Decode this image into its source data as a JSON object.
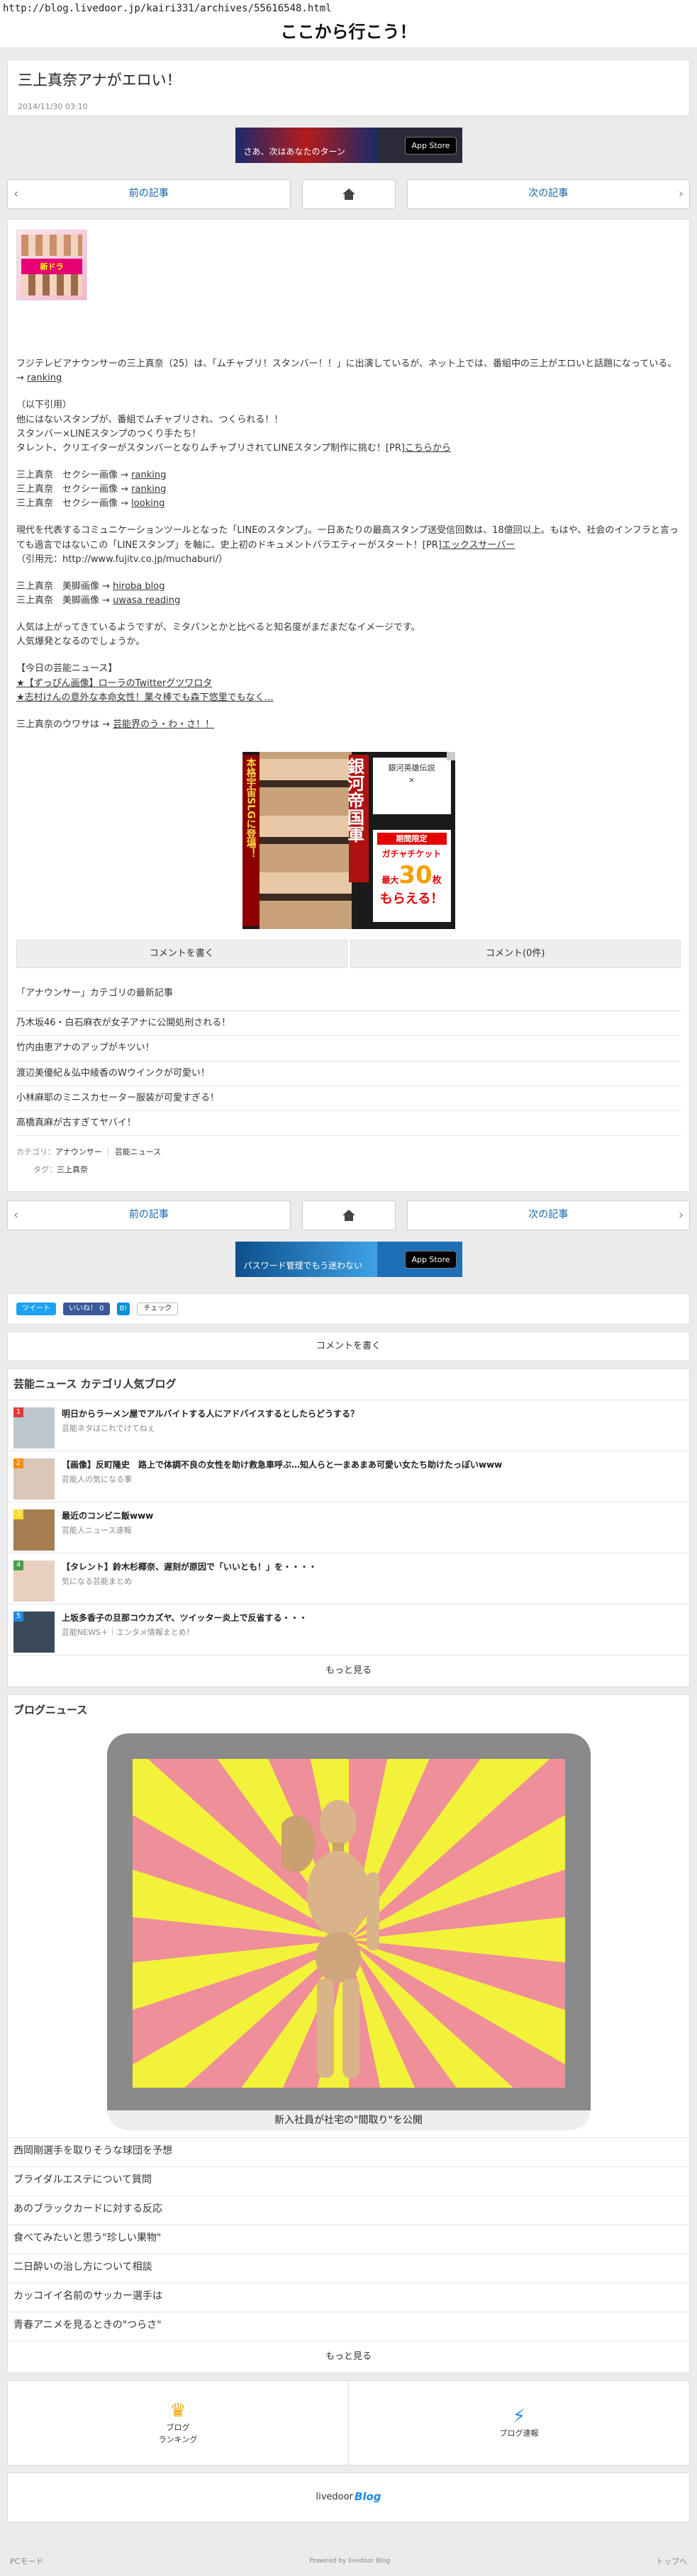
{
  "url": "http://blog.livedoor.jp/kairi331/archives/55616548.html",
  "blog_title": "ここから行こう！",
  "article": {
    "title": "三上真奈アナがエロい！",
    "date": "2014/11/30 03:10",
    "intro": "フジテレビアナウンサーの三上真奈（25）は、「ムチャブリ！スタンバー！！」に出演しているが、ネット上では、番組中の三上がエロいと話題になっている。→",
    "intro_link": "ranking",
    "quote_lines": [
      "（以下引用）",
      "他にはないスタンプが、番組でムチャブリされ、つくられる！！",
      "スタンバー×LINEスタンプのつくり手たち！",
      "タレント、クリエイターがスタンバーとなりムチャブリされてLINEスタンプ制作に挑む！[PR]"
    ],
    "quote_link": "こちらから",
    "sexy_lines": [
      {
        "prefix": "三上真奈　セクシー画像 →",
        "link": "ranking"
      },
      {
        "prefix": "三上真奈　セクシー画像 →",
        "link": "ranking"
      },
      {
        "prefix": "三上真奈　セクシー画像 →",
        "link": "looking"
      }
    ],
    "line_para": "現代を代表するコミュニケーションツールとなった「LINEのスタンプ」。一日あたりの最高スタンプ送受信回数は、18億回以上。もはや、社会のインフラと言っても過言ではないこの「LINEスタンプ」を軸に、史上初のドキュメントバラエティーがスタート！[PR]",
    "line_link": "エックスサーバー",
    "citation": "（引用元：http://www.fujitv.co.jp/muchaburi/）",
    "beauty_lines": [
      {
        "prefix": "三上真奈　美脚画像 →",
        "link": "hiroba blog"
      },
      {
        "prefix": "三上真奈　美脚画像 →",
        "link": "uwasa reading"
      }
    ],
    "opinion_lines": [
      "人気は上がってきているようですが、ミタパンとかと比べると知名度がまだまだなイメージです。",
      "人気爆発となるのでしょうか。"
    ],
    "news_heading": "【今日の芸能ニュース】",
    "news_links": [
      "★【ずっぴん画像】ローラのTwitterグツワロタ",
      "★志村けんの意外な本命女性！業々棒でも森下悠里でもなく…"
    ],
    "rumor_prefix": "三上真奈のウワサは →",
    "rumor_link": "芸能界のう・わ・さ！！"
  },
  "banner1": {
    "text": "さあ、次はあなたのターン",
    "store": "App Store"
  },
  "banner2": {
    "text": "パスワード管理でもう迷わない",
    "store": "App Store"
  },
  "thumb_text": "新ドラ",
  "ad": {
    "vtext": "本格宇宙SLGに登場！",
    "vtext2": "銀河帝国軍",
    "logo_title": "銀河英雄伝説",
    "logo_sub": "×",
    "gacha_period": "期間限定",
    "gacha_label": "ガチャチケット",
    "gacha_count": "30",
    "gacha_max": "最大",
    "gacha_unit": "枚",
    "gacha_end": "もらえる！"
  },
  "nav": {
    "prev": "前の記事",
    "next": "次の記事"
  },
  "comments": {
    "write": "コメントを書く",
    "count": "コメント(0件)"
  },
  "category": {
    "heading": "「アナウンサー」カテゴリの最新記事",
    "items": [
      "乃木坂46・白石麻衣が女子アナに公開処刑される！",
      "竹内由恵アナのアップがキツい！",
      "渡辺美優紀＆弘中綾香のWウインクが可愛い！",
      "小林麻耶のミニスカセーター服装が可愛すぎる！",
      "高橋真麻が古すぎてヤバイ！"
    ],
    "meta_cat_label": "カテゴリ：",
    "meta_cat1": "アナウンサー",
    "meta_cat2": "芸能ニュース",
    "meta_tag_label": "タグ：",
    "meta_tag": "三上真奈"
  },
  "share": {
    "tweet": "ツイート",
    "like": "いいね！ 0",
    "hatena": "B!",
    "check": "チェック"
  },
  "write_comment": "コメントを書く",
  "popular": {
    "title": "芸能ニュース カテゴリ人気ブログ",
    "items": [
      {
        "rank": "1",
        "title": "明日からラーメン屋でアルバイトする人にアドバイスするとしたらどうする？",
        "src": "芸能ネタはこれでけてねぇ",
        "color": "#e53935"
      },
      {
        "rank": "2",
        "title": "【画像】反町隆史　路上で体調不良の女性を助け救急車呼ぶ…知人らと一まあまあ可愛い女たち助けたっぽいwww",
        "src": "芸能人の気になる事",
        "color": "#fb8c00"
      },
      {
        "rank": "3",
        "title": "最近のコンビニ飯www",
        "src": "芸能人ニュース速報",
        "color": "#fdd835"
      },
      {
        "rank": "4",
        "title": "【タレント】鈴木杉椰奈、遅刻が原因で「いいとも！」を・・・・",
        "src": "気になる芸能まとめ",
        "color": "#43a047"
      },
      {
        "rank": "5",
        "title": "上坂多香子の旦那コウカズヤ、ツイッター炎上で反省する・・・",
        "src": "芸能NEWS＋｜エンタメ情報まとめ！",
        "color": "#1e88e5"
      }
    ],
    "more": "もっと見る"
  },
  "blog_news": {
    "title": "ブログニュース",
    "caption": "新入社員が社宅の\"間取り\"を公開",
    "items": [
      "西岡剛選手を取りそうな球団を予想",
      "ブライダルエステについて質問",
      "あのブラックカードに対する反応",
      "食べてみたいと思う\"珍しい果物\"",
      "二日酔いの治し方について相談",
      "カッコイイ名前のサッカー選手は",
      "青春アニメを見るときの\"つらさ\""
    ],
    "more": "もっと見る"
  },
  "footer_links": {
    "ranking": "ブログ\nランキング",
    "news": "ブログ速報"
  },
  "livedoor": {
    "brand": "livedoor",
    "blog": "Blog"
  },
  "footer": {
    "pc": "PCモード",
    "powered": "Powered by livedoor Blog",
    "top": "トップへ"
  }
}
